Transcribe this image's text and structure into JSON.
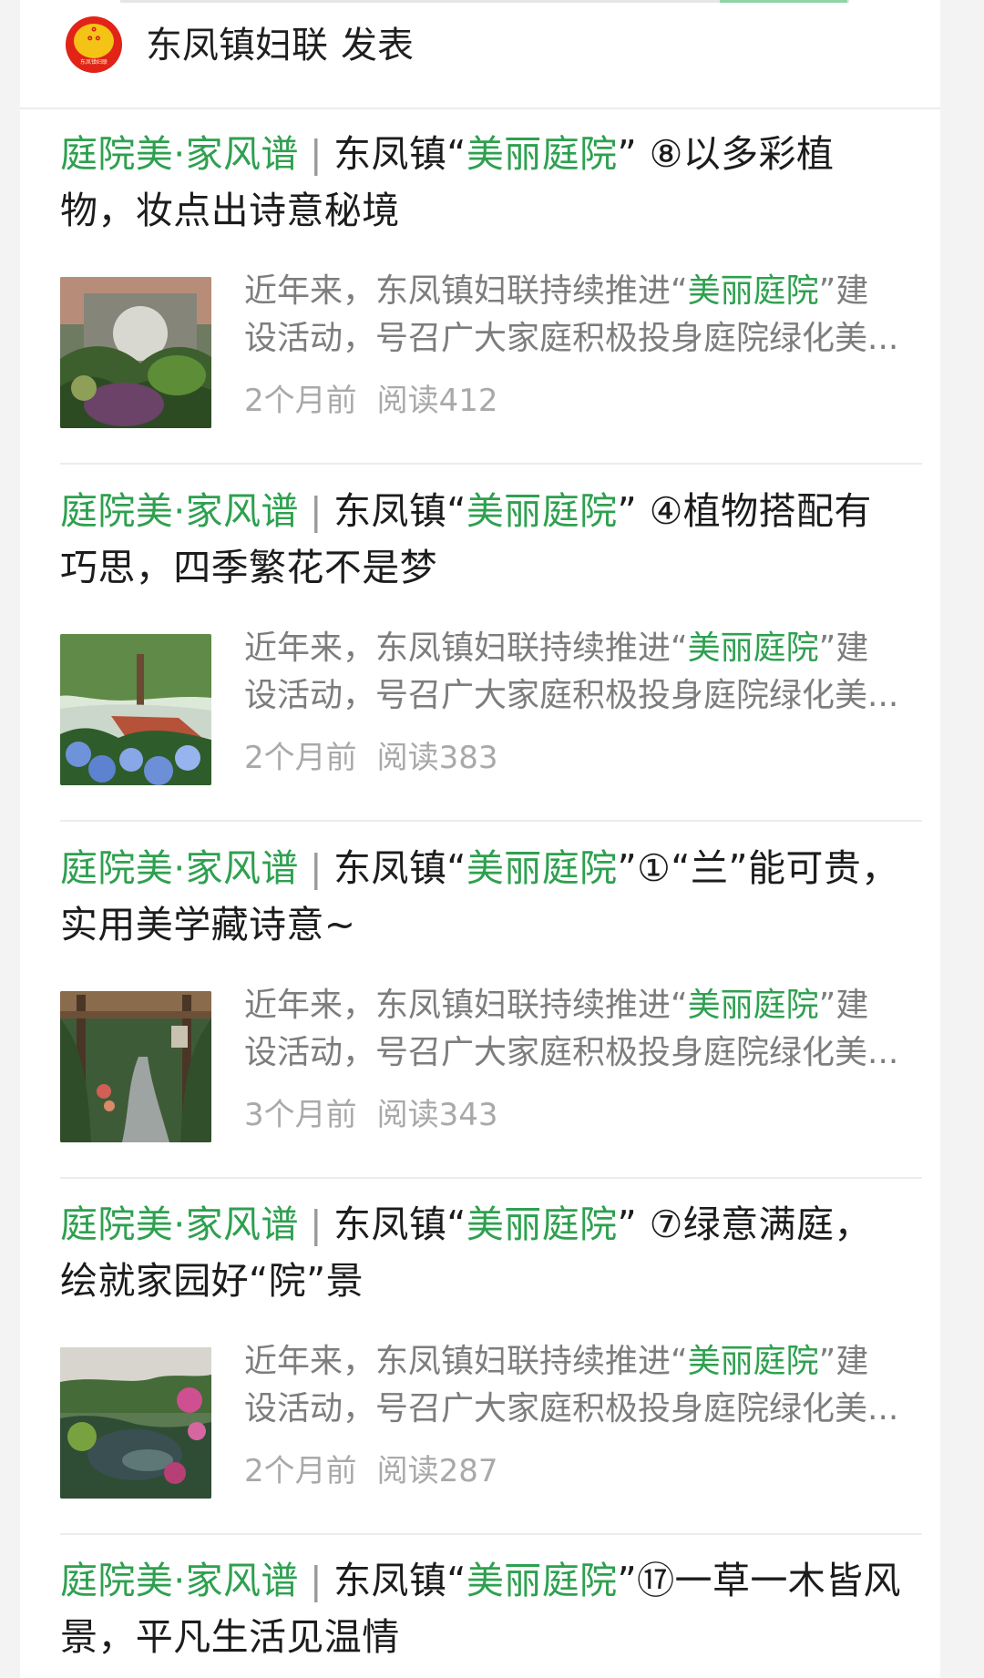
{
  "account": {
    "name": "东凤镇妇联",
    "action": "发表",
    "logo_caption": "东凤镇妇联"
  },
  "theme": {
    "accent": "#2ea04f",
    "muted": "#7d7d7d",
    "meta": "#a9a9a9"
  },
  "articles": [
    {
      "series": "庭院美·家风谱",
      "separator": "|",
      "title_prefix": "东凤镇“",
      "title_highlight": "美丽庭院",
      "title_rest": "” ⑧以多彩植物，妆点出诗意秘境",
      "excerpt_prefix": "近年来，东凤镇妇联持续推进“",
      "excerpt_highlight": "美丽庭院",
      "excerpt_suffix": "”建",
      "excerpt_line2": "设活动，号召广大家庭积极投身庭院绿化美...",
      "time": "2个月前",
      "reads": "阅读412",
      "thumb_icon": "garden-moon-gate-photo"
    },
    {
      "series": "庭院美·家风谱",
      "separator": "|",
      "title_prefix": "东凤镇“",
      "title_highlight": "美丽庭院",
      "title_rest": "” ④植物搭配有巧思，四季繁花不是梦",
      "excerpt_prefix": "近年来，东凤镇妇联持续推进“",
      "excerpt_highlight": "美丽庭院",
      "excerpt_suffix": "”建",
      "excerpt_line2": "设活动，号召广大家庭积极投身庭院绿化美...",
      "time": "2个月前",
      "reads": "阅读383",
      "thumb_icon": "hydrangea-garden-photo"
    },
    {
      "series": "庭院美·家风谱",
      "separator": "|",
      "title_prefix": "东凤镇“",
      "title_highlight": "美丽庭院",
      "title_rest": "”①“兰”能可贵，实用美学藏诗意~",
      "excerpt_prefix": "近年来，东凤镇妇联持续推进“",
      "excerpt_highlight": "美丽庭院",
      "excerpt_suffix": "”建",
      "excerpt_line2": "设活动，号召广大家庭积极投身庭院绿化美...",
      "time": "3个月前",
      "reads": "阅读343",
      "thumb_icon": "pergola-path-photo"
    },
    {
      "series": "庭院美·家风谱",
      "separator": "|",
      "title_prefix": "东凤镇“",
      "title_highlight": "美丽庭院",
      "title_rest": "” ⑦绿意满庭，绘就家园好“院”景",
      "excerpt_prefix": "近年来，东凤镇妇联持续推进“",
      "excerpt_highlight": "美丽庭院",
      "excerpt_suffix": "”建",
      "excerpt_line2": "设活动，号召广大家庭积极投身庭院绿化美...",
      "time": "2个月前",
      "reads": "阅读287",
      "thumb_icon": "pond-garden-photo"
    },
    {
      "series": "庭院美·家风谱",
      "separator": "|",
      "title_prefix": "东凤镇“",
      "title_highlight": "美丽庭院",
      "title_rest": "”⑰一草一木皆风景，平凡生活见温情"
    }
  ]
}
